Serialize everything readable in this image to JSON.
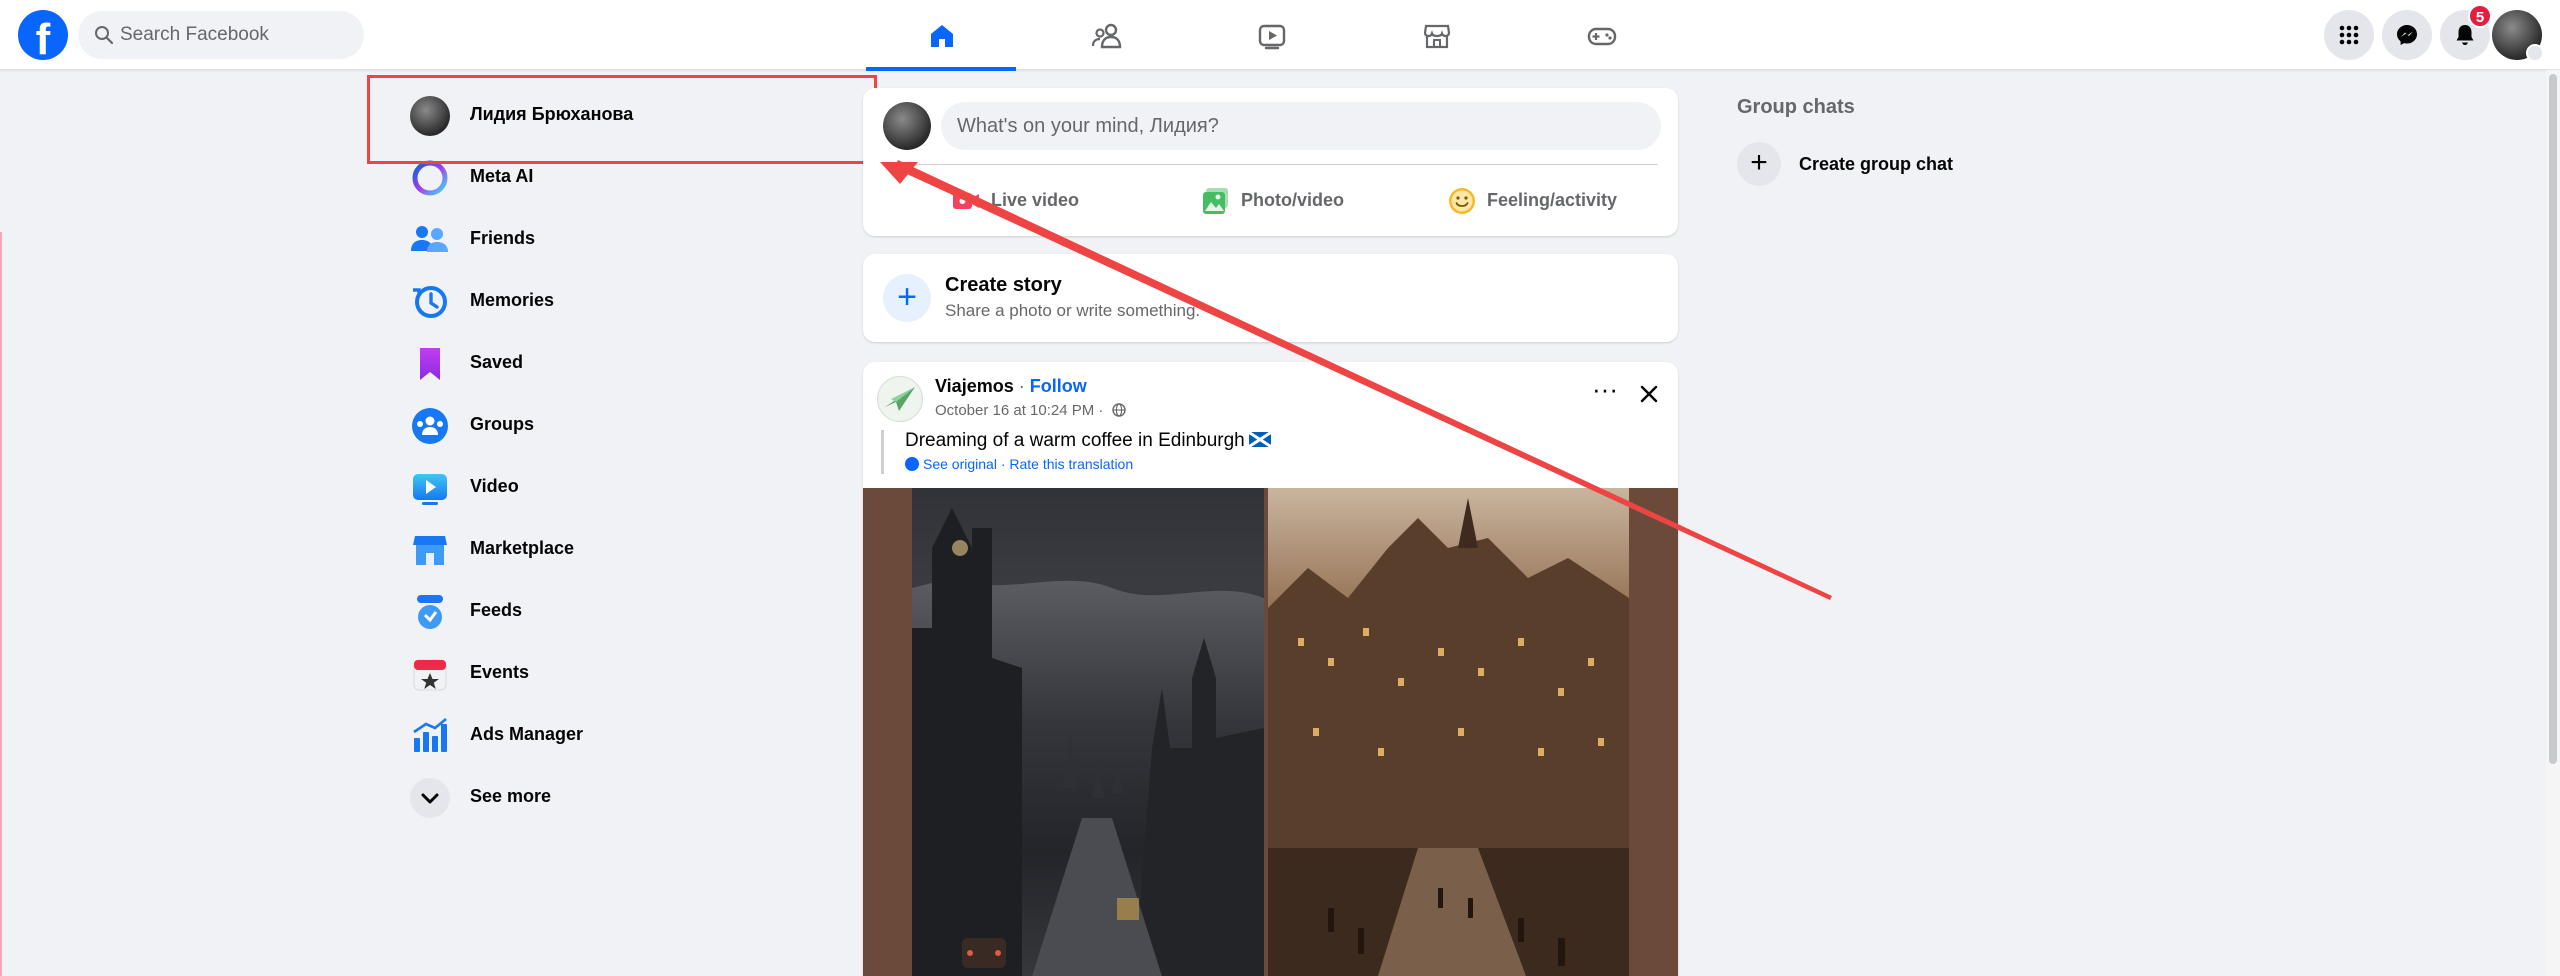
{
  "topbar": {
    "search_placeholder": "Search Facebook",
    "logo_letter": "f",
    "nav_tabs": [
      "home",
      "friends",
      "video",
      "marketplace",
      "gaming"
    ],
    "active_tab": "home",
    "notifications_count": "5"
  },
  "sidebar": {
    "items": [
      {
        "label": "Лидия Брюханова",
        "icon": "profile-avatar"
      },
      {
        "label": "Meta AI",
        "icon": "meta-ai-icon"
      },
      {
        "label": "Friends",
        "icon": "friends-icon"
      },
      {
        "label": "Memories",
        "icon": "memories-icon"
      },
      {
        "label": "Saved",
        "icon": "saved-icon"
      },
      {
        "label": "Groups",
        "icon": "groups-icon"
      },
      {
        "label": "Video",
        "icon": "video-icon"
      },
      {
        "label": "Marketplace",
        "icon": "marketplace-icon"
      },
      {
        "label": "Feeds",
        "icon": "feeds-icon"
      },
      {
        "label": "Events",
        "icon": "events-icon"
      },
      {
        "label": "Ads Manager",
        "icon": "ads-manager-icon"
      },
      {
        "label": "See more",
        "icon": "chevron-down-icon"
      }
    ]
  },
  "composer": {
    "placeholder": "What's on your mind, Лидия?",
    "actions": [
      {
        "label": "Live video",
        "color": "#f3425f"
      },
      {
        "label": "Photo/video",
        "color": "#45bd62"
      },
      {
        "label": "Feeling/activity",
        "color": "#f7b928"
      }
    ]
  },
  "story": {
    "title": "Create story",
    "subtitle": "Share a photo or write something."
  },
  "post": {
    "author": "Viajemos",
    "separator": " · ",
    "follow": "Follow",
    "meta": "October 16 at 10:24 PM ·",
    "text": "Dreaming of a warm coffee in Edinburgh",
    "see_original": "See original",
    "translate_sep": " · ",
    "rate": "Rate this translation"
  },
  "right_rail": {
    "title": "Group chats",
    "create": "Create group chat"
  },
  "colors": {
    "brand": "#0866ff",
    "annotation": "#ef4444"
  }
}
